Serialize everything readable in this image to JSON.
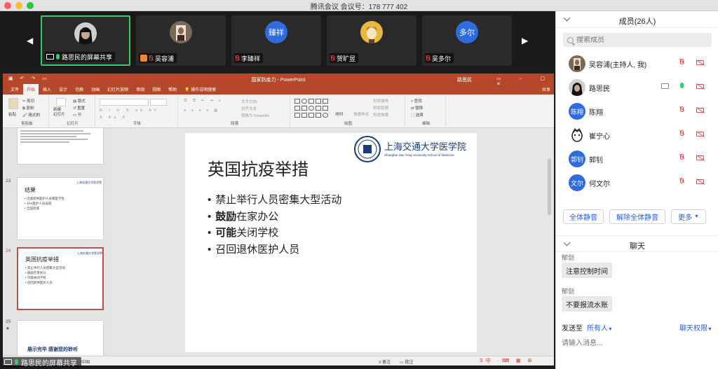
{
  "window": {
    "title": "腾讯会议 会议号：178 777 402"
  },
  "video_strip": {
    "tiles": [
      {
        "name": "路思民的屏幕共享",
        "avatar": "avatar-photo"
      },
      {
        "name": "吴容浦",
        "avatar": "avatar-photo"
      },
      {
        "name": "李臻祥",
        "avatar_text": "臻祥"
      },
      {
        "name": "贺旷昱",
        "avatar": "avatar-photo"
      },
      {
        "name": "吴多尔",
        "avatar_text": "多尔"
      }
    ]
  },
  "ppt": {
    "title": "国家防疫力 - PowerPoint",
    "user": "路思民",
    "tabs": [
      "文件",
      "开始",
      "插入",
      "设计",
      "切换",
      "动画",
      "幻灯片放映",
      "审阅",
      "视图",
      "帮助",
      "操作说明搜索"
    ],
    "share_label": "共享",
    "ribbon": {
      "clipboard": {
        "label": "剪贴板",
        "paste": "粘贴",
        "cut": "剪切",
        "copy": "复制",
        "format_painter": "格式刷"
      },
      "slides": {
        "label": "幻灯片",
        "new_slide": "新建\n幻灯片",
        "layout": "版式",
        "reset": "重置",
        "section": "节"
      },
      "font": {
        "label": "字体"
      },
      "paragraph": {
        "label": "段落",
        "text_direction": "文字方向",
        "align_text": "对齐文本",
        "smartart": "转换为 SmartArt"
      },
      "drawing": {
        "label": "绘图",
        "arrange": "排列",
        "quick_styles": "快速样式",
        "fill": "形状填充",
        "outline": "形状轮廓",
        "effects": "形状效果"
      },
      "editing": {
        "label": "编辑",
        "find": "查找",
        "replace": "替换",
        "select": "选择"
      }
    },
    "thumbnails": [
      {
        "num": "23",
        "title": "结果",
        "lines": [
          "• 迅速退休医护人员和医学生",
          "• 分%医护人员返岗",
          "• 全国封城"
        ]
      },
      {
        "num": "24",
        "title": "英国抗疫举措",
        "lines": [
          "• 禁止举行人员密集大型活动",
          "• 鼓励在家办公",
          "• 可能关闭学校",
          "• 召回退休医护人员"
        ]
      },
      {
        "num": "25",
        "title": "展示完毕 感谢您的聆听"
      }
    ],
    "slide": {
      "title": "英国抗疫举措",
      "bullets": [
        {
          "bold": "",
          "text": "禁止举行人员密集大型活动"
        },
        {
          "bold": "鼓励",
          "text": "在家办公"
        },
        {
          "bold": "可能",
          "text": "关闭学校"
        },
        {
          "bold": "",
          "text": "召回退休医护人员"
        }
      ],
      "logo_cn": "上海交通大学医学院",
      "logo_en": "Shanghai Jiao Tong University School of Medicine"
    },
    "status": {
      "lang": "中国",
      "notes": "备注",
      "comments": "批注"
    }
  },
  "bottom_share": {
    "label": "路思民的屏幕共享"
  },
  "members": {
    "title": "成员(26人)",
    "search_placeholder": "搜索成员",
    "list": [
      {
        "name": "吴容浦(主持人, 我)",
        "avatar": "photo"
      },
      {
        "name": "路思民",
        "avatar": "photo",
        "sharing": true
      },
      {
        "name": "陈翔",
        "avatar_text": "陈翔"
      },
      {
        "name": "崔宁心",
        "avatar": "cartoon"
      },
      {
        "name": "郭钊",
        "avatar_text": "郭钊"
      },
      {
        "name": "何文尔",
        "avatar_text": "文尔"
      }
    ],
    "mute_all": "全体静音",
    "unmute_all": "解除全体静音",
    "more": "更多"
  },
  "chat": {
    "title": "聊天",
    "messages": [
      {
        "sender": "郁剑",
        "text": "注意控制时间"
      },
      {
        "sender": "郁剑",
        "text": "不要报流水账"
      }
    ],
    "send_to_label": "发送至",
    "send_to_value": "所有人",
    "permission": "聊天权限",
    "input_placeholder": "请输入消息..."
  },
  "colors": {
    "ppt_red": "#b7472a",
    "accent_blue": "#2f6bdc",
    "share_green": "#3ac96b"
  }
}
